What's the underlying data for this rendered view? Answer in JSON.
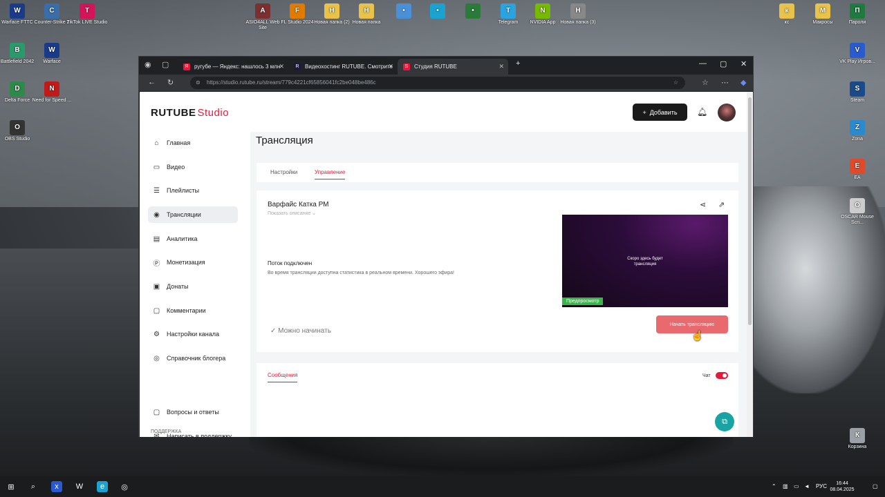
{
  "desktop_icons": [
    {
      "label": "Warface FTTC",
      "icon": "warface-icon",
      "color": "#1a3a8a"
    },
    {
      "label": "Counter-Strike 2",
      "icon": "counter-strike-icon",
      "color": "#3a6ea8"
    },
    {
      "label": "TikTok LIVE Studio",
      "icon": "tiktok-icon",
      "color": "#d4145a"
    },
    {
      "label": "ASIO4ALL Web Site",
      "icon": "asio-icon",
      "color": "#7a3030"
    },
    {
      "label": "FL Studio 2024",
      "icon": "fl-studio-icon",
      "color": "#e07b00"
    },
    {
      "label": "Новая папка (2)",
      "icon": "folder-icon",
      "color": "#e8c24a"
    },
    {
      "label": "Новая папка",
      "icon": "folder-icon",
      "color": "#e8c24a"
    },
    {
      "label": "",
      "icon": "monitor-icon",
      "color": "#4a90d9"
    },
    {
      "label": "",
      "icon": "edge-icon",
      "color": "#1aa3d0"
    },
    {
      "label": "",
      "icon": "cs-icon",
      "color": "#2a7a3a"
    },
    {
      "label": "Telegram",
      "icon": "telegram-icon",
      "color": "#2aa3e0"
    },
    {
      "label": "NVIDIA App",
      "icon": "nvidia-icon",
      "color": "#76b900"
    },
    {
      "label": "Новая папка (3)",
      "icon": "music-folder-icon",
      "color": "#888888"
    },
    {
      "label": "кс",
      "icon": "folder-icon",
      "color": "#e8c24a"
    },
    {
      "label": "Макросы",
      "icon": "folder-icon",
      "color": "#e8c24a"
    },
    {
      "label": "Пароли",
      "icon": "excel-icon",
      "color": "#1e7a3e"
    },
    {
      "label": "Battlefield 2042",
      "icon": "battlefield-icon",
      "color": "#2a9a6a"
    },
    {
      "label": "Warface",
      "icon": "warface-icon",
      "color": "#1a3a8a"
    },
    {
      "label": "Delta Force",
      "icon": "delta-force-icon",
      "color": "#2e8a4a"
    },
    {
      "label": "Need for Speed ...",
      "icon": "nfs-icon",
      "color": "#c01a1a"
    },
    {
      "label": "OBS Studio",
      "icon": "obs-icon",
      "color": "#333333"
    },
    {
      "label": "VK Play Игров...",
      "icon": "vk-play-icon",
      "color": "#2a5ad0"
    },
    {
      "label": "Steam",
      "icon": "steam-icon",
      "color": "#1b4a8a"
    },
    {
      "label": "Zona",
      "icon": "zona-icon",
      "color": "#2a8ad0"
    },
    {
      "label": "EA",
      "icon": "ea-icon",
      "color": "#e04a2a"
    },
    {
      "label": "OSCAR Mouse Scri...",
      "icon": "oscar-icon",
      "color": "#cccccc"
    },
    {
      "label": "Корзина",
      "icon": "recycle-bin-icon",
      "color": "#9aa0a6"
    }
  ],
  "browser": {
    "tabs": [
      {
        "label": "ругубе — Яндекс: нашлось 3 млн",
        "favicon": "yandex-icon",
        "fav_color": "#e6193c",
        "active": false
      },
      {
        "label": "Видеохостинг RUTUBE. Смотрите",
        "favicon": "rutube-icon",
        "fav_color": "#1a1a3a",
        "active": false
      },
      {
        "label": "Студия RUTUBE",
        "favicon": "rutube-studio-icon",
        "fav_color": "#e6193c",
        "active": true
      }
    ],
    "url": "https://studio.rutube.ru/stream/779c4221cf65856041fc2be048be486c"
  },
  "header": {
    "logo_main": "RUTUBE",
    "logo_sub": "Studio",
    "add_label": "Добавить"
  },
  "sidebar": {
    "items": [
      {
        "label": "Главная",
        "icon": "home-icon",
        "glyph": "⌂"
      },
      {
        "label": "Видео",
        "icon": "video-icon",
        "glyph": "▭"
      },
      {
        "label": "Плейлисты",
        "icon": "playlist-icon",
        "glyph": "☰"
      },
      {
        "label": "Трансляции",
        "icon": "broadcast-icon",
        "glyph": "◉"
      },
      {
        "label": "Аналитика",
        "icon": "analytics-icon",
        "glyph": "▤"
      },
      {
        "label": "Монетизация",
        "icon": "monetization-icon",
        "glyph": "Ⓟ"
      },
      {
        "label": "Донаты",
        "icon": "donate-icon",
        "glyph": "▣"
      },
      {
        "label": "Комментарии",
        "icon": "comments-icon",
        "glyph": "▢"
      },
      {
        "label": "Настройки канала",
        "icon": "settings-icon",
        "glyph": "⚙"
      },
      {
        "label": "Справочник блогера",
        "icon": "guide-icon",
        "glyph": "◎"
      },
      {
        "label": "Вопросы и ответы",
        "icon": "faq-icon",
        "glyph": "▢"
      },
      {
        "label": "Написать в поддержку",
        "icon": "mail-icon",
        "glyph": "✉"
      }
    ],
    "active_index": 3,
    "group_label": "ПОДДЕРЖКА"
  },
  "main": {
    "title": "Трансляция",
    "tabs": [
      "Настройки",
      "Управление"
    ],
    "active_tab": 1,
    "stream": {
      "title": "Варфайс Катка РМ",
      "show_description": "Показать описание ⌄",
      "status_title": "Поток подключен",
      "status_text": "Во время трансляции доступна статистика в реальном времени. Хорошего эфира!",
      "preview_text": "Скоро здесь будет трансляция",
      "preview_badge": "Предпросмотр",
      "ready_text": "✓  Можно начинать",
      "start_button": "Начать трансляцию"
    },
    "chat": {
      "tab_label": "Сообщения",
      "toggle_label": "Чат",
      "enabled": true
    }
  },
  "taskbar": {
    "language": "РУС",
    "time": "16:44",
    "date": "08.04.2025"
  },
  "colors": {
    "accent": "#e6193c",
    "start_button": "#e86a6e",
    "preview_badge": "#39b54a"
  }
}
